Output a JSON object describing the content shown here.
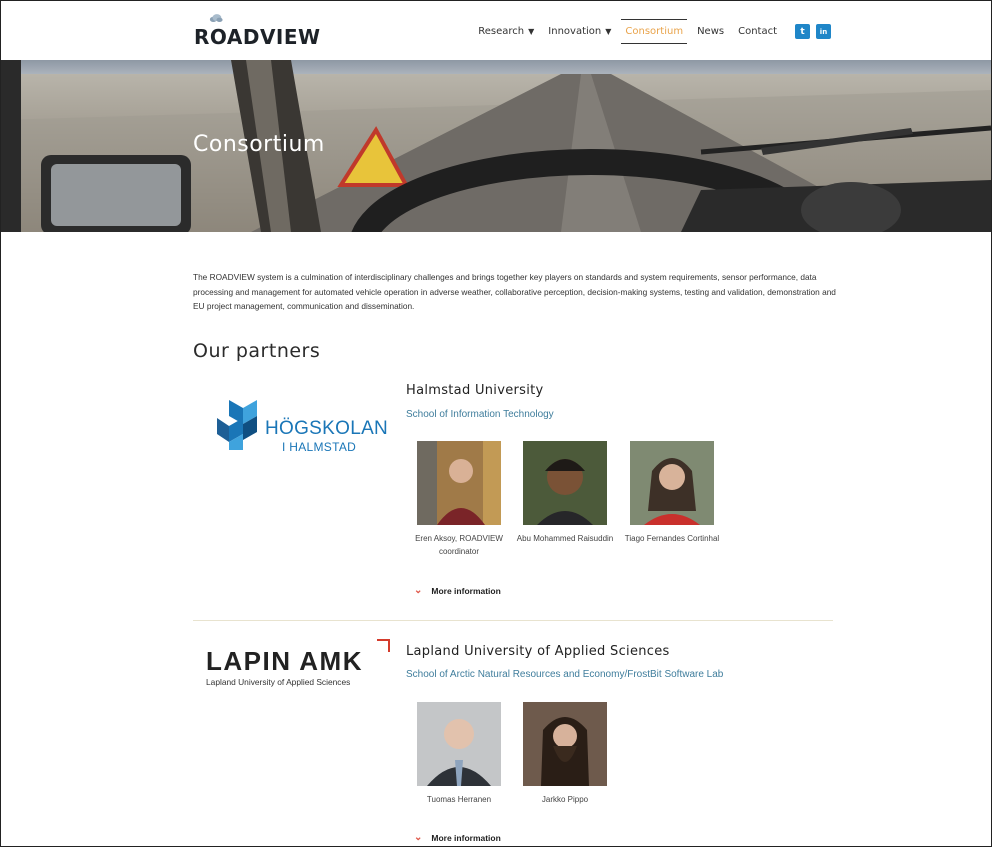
{
  "header": {
    "logo_text": "ROADVIEW",
    "nav": [
      {
        "label": "Research",
        "caret": "▼"
      },
      {
        "label": "Innovation",
        "caret": "▼"
      },
      {
        "label": "Consortium"
      },
      {
        "label": "News"
      },
      {
        "label": "Contact"
      }
    ],
    "social": {
      "twitter": "t",
      "linkedin": "in"
    }
  },
  "hero": {
    "title": "Consortium"
  },
  "intro": "The ROADVIEW system is a culmination of interdisciplinary challenges and brings together key players on standards and system requirements, sensor performance, data processing and management for automated vehicle operation in adverse weather, collaborative perception, decision-making systems, testing and validation, demonstration and EU project management, communication and dissemination.",
  "partners_heading": "Our partners",
  "partners": [
    {
      "logo_line1": "HÖGSKOLAN",
      "logo_line2": "I HALMSTAD",
      "name": "Halmstad University",
      "school": "School of Information Technology",
      "people": [
        {
          "name": "Eren Aksoy, ROADVIEW coordinator"
        },
        {
          "name": "Abu Mohammed Raisuddin"
        },
        {
          "name": "Tiago Fernandes Cortinhal"
        }
      ],
      "more": "More information"
    },
    {
      "logo_line1": "LAPIN AMK",
      "logo_line2": "Lapland University of Applied Sciences",
      "name": "Lapland University of Applied Sciences",
      "school": "School of Arctic Natural Resources and Economy/FrostBit Software Lab",
      "people": [
        {
          "name": "Tuomas Herranen"
        },
        {
          "name": "Jarkko Pippo"
        }
      ],
      "more": "More information"
    }
  ],
  "colors": {
    "accent": "#e9a34a",
    "link": "#3f7d9c",
    "social": "#1f86c8",
    "chevron": "#e0584a",
    "halmstad_blue": "#1a76b7"
  }
}
